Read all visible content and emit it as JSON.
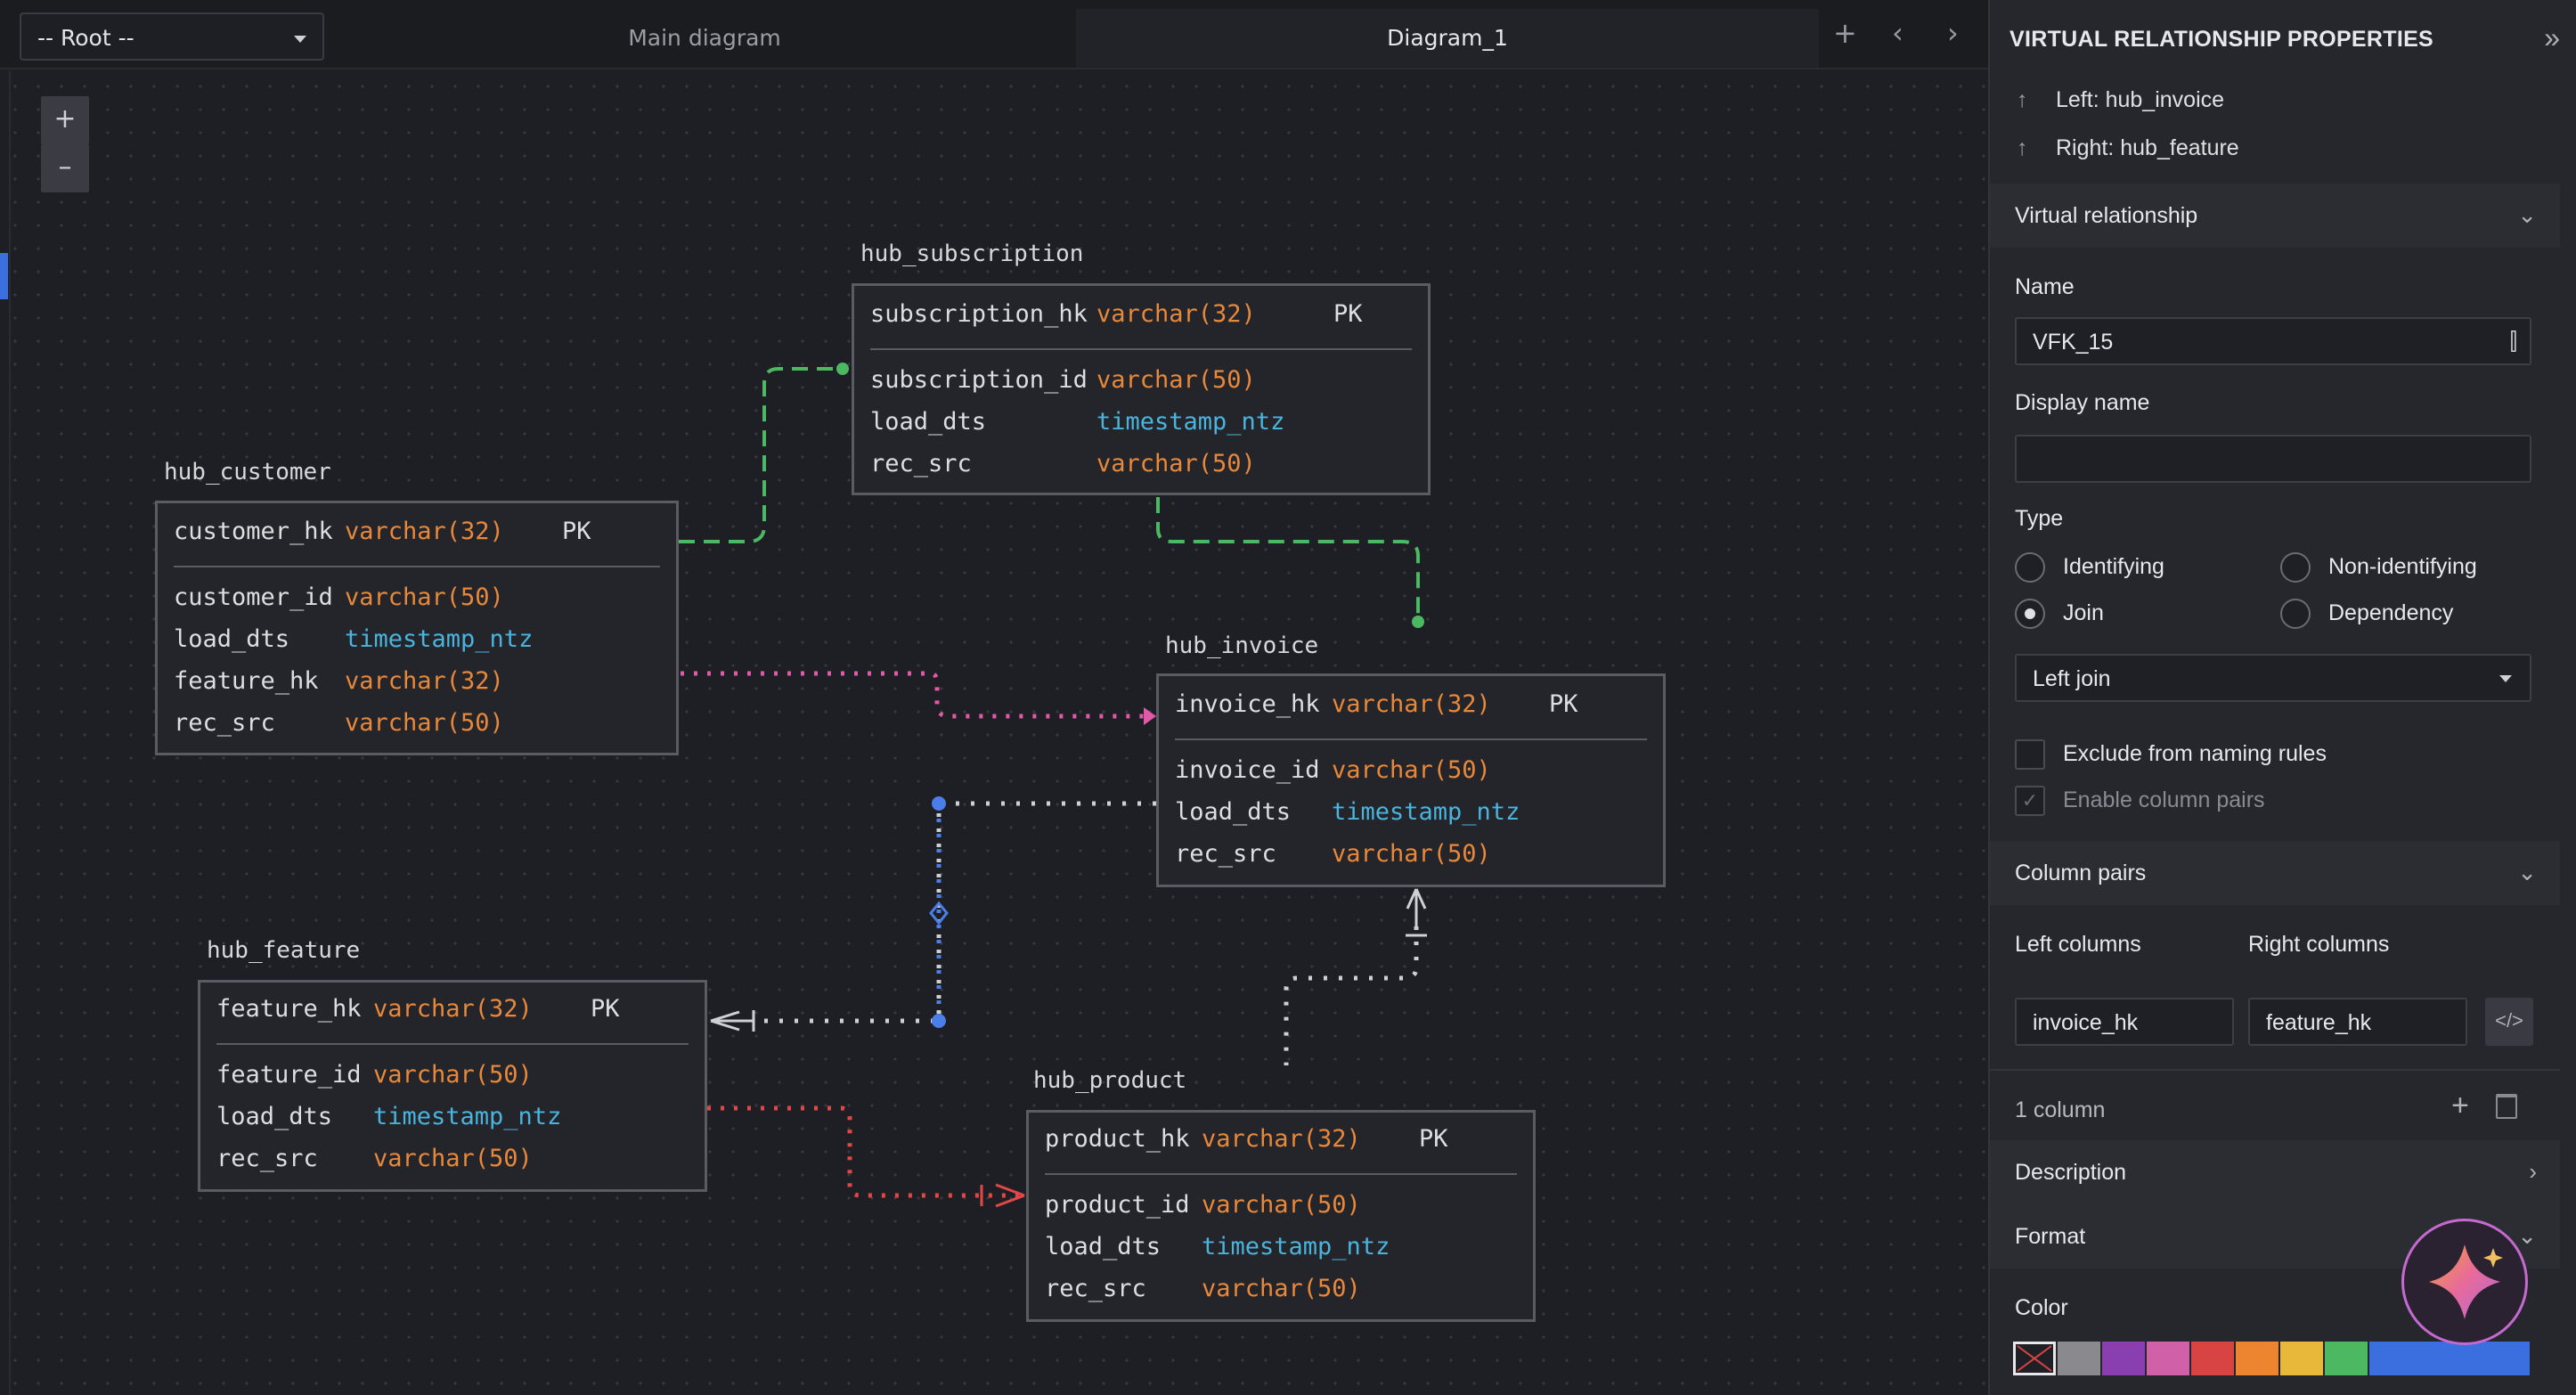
{
  "topbar": {
    "root_select": "-- Root --",
    "tabs": [
      "Main diagram",
      "Diagram_1"
    ],
    "add_icon": "plus-icon",
    "prev_icon": "chevron-left-icon",
    "next_icon": "chevron-right-icon"
  },
  "canvas": {
    "zoom_in": "+",
    "zoom_out": "–"
  },
  "entities": {
    "hub_subscription": {
      "title": "hub_subscription",
      "pk": {
        "name": "subscription_hk",
        "type": "varchar(32)",
        "flag": "PK"
      },
      "cols": [
        {
          "name": "subscription_id",
          "type": "varchar(50)"
        },
        {
          "name": "load_dts",
          "type": "timestamp_ntz"
        },
        {
          "name": "rec_src",
          "type": "varchar(50)"
        }
      ]
    },
    "hub_customer": {
      "title": "hub_customer",
      "pk": {
        "name": "customer_hk",
        "type": "varchar(32)",
        "flag": "PK"
      },
      "cols": [
        {
          "name": "customer_id",
          "type": "varchar(50)"
        },
        {
          "name": "load_dts",
          "type": "timestamp_ntz"
        },
        {
          "name": "feature_hk",
          "type": "varchar(32)"
        },
        {
          "name": "rec_src",
          "type": "varchar(50)"
        }
      ]
    },
    "hub_invoice": {
      "title": "hub_invoice",
      "pk": {
        "name": "invoice_hk",
        "type": "varchar(32)",
        "flag": "PK"
      },
      "cols": [
        {
          "name": "invoice_id",
          "type": "varchar(50)"
        },
        {
          "name": "load_dts",
          "type": "timestamp_ntz"
        },
        {
          "name": "rec_src",
          "type": "varchar(50)"
        }
      ]
    },
    "hub_feature": {
      "title": "hub_feature",
      "pk": {
        "name": "feature_hk",
        "type": "varchar(32)",
        "flag": "PK"
      },
      "cols": [
        {
          "name": "feature_id",
          "type": "varchar(50)"
        },
        {
          "name": "load_dts",
          "type": "timestamp_ntz"
        },
        {
          "name": "rec_src",
          "type": "varchar(50)"
        }
      ]
    },
    "hub_product": {
      "title": "hub_product",
      "pk": {
        "name": "product_hk",
        "type": "varchar(32)",
        "flag": "PK"
      },
      "cols": [
        {
          "name": "product_id",
          "type": "varchar(50)"
        },
        {
          "name": "load_dts",
          "type": "timestamp_ntz"
        },
        {
          "name": "rec_src",
          "type": "varchar(50)"
        }
      ]
    }
  },
  "colors": {
    "green_rel": "#4cb962",
    "pink_rel": "#e05aa8",
    "blue_rel": "#4a7ee8",
    "white_rel": "#cfcfd4",
    "red_rel": "#e04848",
    "type_orange": "#e8883a",
    "type_cyan": "#4ab4dc"
  },
  "panel": {
    "title": "VIRTUAL RELATIONSHIP PROPERTIES",
    "left": "Left: hub_invoice",
    "right": "Right: hub_feature",
    "section_vr": "Virtual relationship",
    "name_label": "Name",
    "name_value": "VFK_15",
    "display_name_label": "Display name",
    "display_name_value": "",
    "type_label": "Type",
    "types": [
      "Identifying",
      "Non-identifying",
      "Join",
      "Dependency"
    ],
    "selected_type": "Join",
    "join_select": "Left join",
    "exclude_label": "Exclude from naming rules",
    "enable_pairs_label": "Enable column pairs",
    "section_pairs": "Column pairs",
    "left_columns_label": "Left columns",
    "right_columns_label": "Right columns",
    "left_column_value": "invoice_hk",
    "right_column_value": "feature_hk",
    "column_count": "1 column",
    "section_description": "Description",
    "section_format": "Format",
    "color_label": "Color",
    "swatches": [
      "#1f2025",
      "#8a8a8e",
      "#8a3fb0",
      "#d061a8",
      "#d84444",
      "#ec8430",
      "#e8b83a",
      "#4cb962",
      "#3b6fe0"
    ]
  }
}
